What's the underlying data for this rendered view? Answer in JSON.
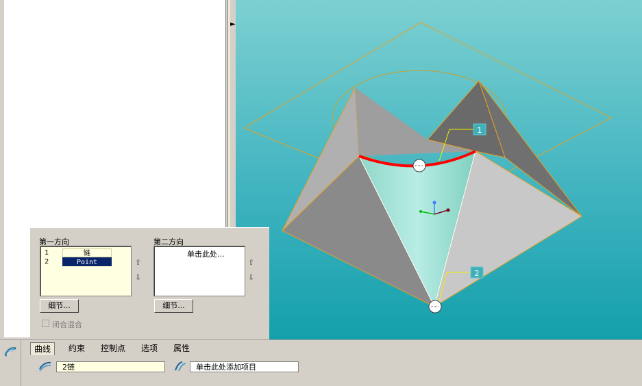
{
  "dialog": {
    "first_direction_label": "第一方向",
    "second_direction_label": "第二方向",
    "first_list": [
      {
        "num": "1",
        "value": "链"
      },
      {
        "num": "2",
        "value": "Point"
      }
    ],
    "second_list_placeholder": "单击此处...",
    "details_button_1": "细节...",
    "details_button_2": "细节...",
    "closed_blend_label": "闭合混合"
  },
  "tabs": [
    "曲线",
    "约束",
    "控制点",
    "选项",
    "属性"
  ],
  "collector_1_value": "2链",
  "collector_2_value": "单击此处添加项目",
  "viewport": {
    "callout_1": "1",
    "callout_2": "2",
    "background_top": "#7dd0d1",
    "background_bottom": "#14a0ac",
    "curve_color": "#ff0000",
    "outline_color": "#e8a020"
  },
  "icons": [
    "splitter-arrow-icon",
    "move-up-icon",
    "move-down-icon",
    "boundary-blend-icon",
    "curve-collector-icon",
    "second-direction-icon"
  ]
}
